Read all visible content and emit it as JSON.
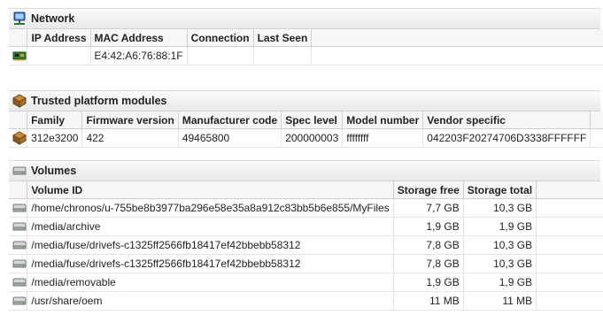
{
  "network": {
    "title": "Network",
    "icon": "network-icon",
    "columns": [
      "IP Address",
      "MAC Address",
      "Connection",
      "Last Seen"
    ],
    "rows": [
      {
        "icon": "network-card-icon",
        "ip": "",
        "mac": "E4:42:A6:76:88:1F",
        "connection": "",
        "last_seen": ""
      }
    ]
  },
  "tpm": {
    "title": "Trusted platform modules",
    "icon": "chip-icon",
    "columns": [
      "Family",
      "Firmware version",
      "Manufacturer code",
      "Spec level",
      "Model number",
      "Vendor specific"
    ],
    "rows": [
      {
        "icon": "chip-icon",
        "family": "312e3200",
        "firmware": "422",
        "manufacturer": "49465800",
        "spec": "200000003",
        "model": "ffffffff",
        "vendor": "042203F20274706D3338FFFFFF"
      }
    ]
  },
  "volumes": {
    "title": "Volumes",
    "icon": "drive-icon",
    "columns": [
      "Volume ID",
      "Storage free",
      "Storage total"
    ],
    "rows": [
      {
        "icon": "drive-icon",
        "id": "/home/chronos/u-755be8b3977ba296e58e35a8a912c83bb5b6e855/MyFiles",
        "free": "7,7 GB",
        "total": "10,3 GB"
      },
      {
        "icon": "drive-icon",
        "id": "/media/archive",
        "free": "1,9 GB",
        "total": "1,9 GB"
      },
      {
        "icon": "drive-icon",
        "id": "/media/fuse/drivefs-c1325ff2566fb18417ef42bbebb58312",
        "free": "7,8 GB",
        "total": "10,3 GB"
      },
      {
        "icon": "drive-icon",
        "id": "/media/fuse/drivefs-c1325ff2566fb18417ef42bbebb58312",
        "free": "7,8 GB",
        "total": "10,3 GB"
      },
      {
        "icon": "drive-icon",
        "id": "/media/removable",
        "free": "1,9 GB",
        "total": "1,9 GB"
      },
      {
        "icon": "drive-icon",
        "id": "/usr/share/oem",
        "free": "11 MB",
        "total": "11 MB"
      }
    ]
  }
}
